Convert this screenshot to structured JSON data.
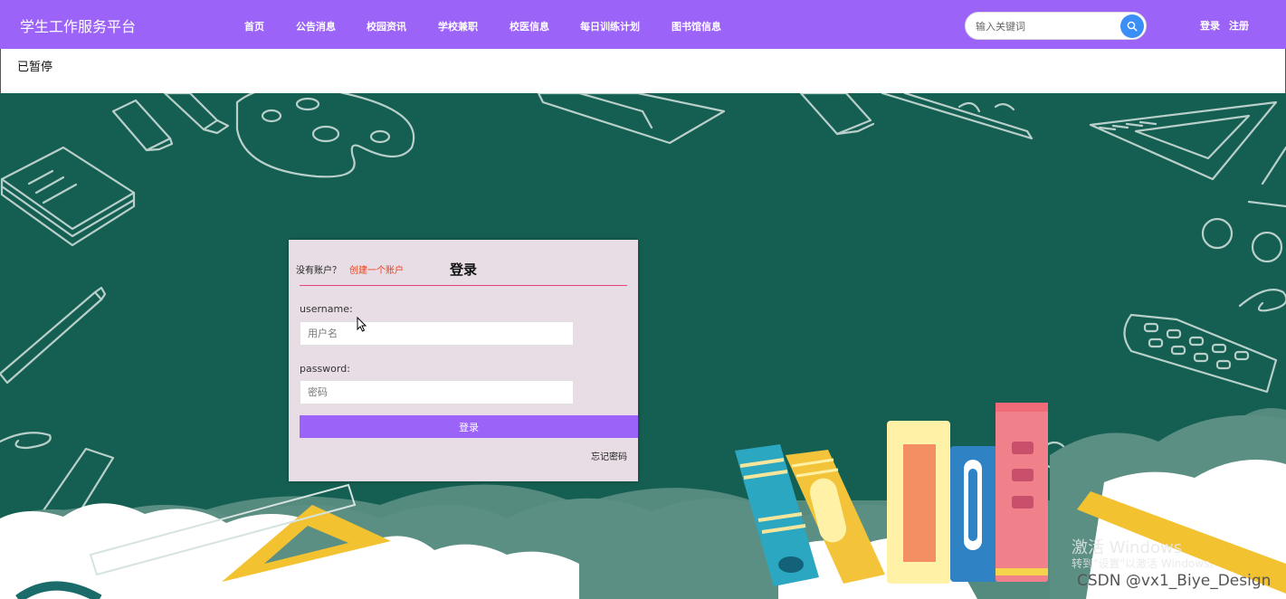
{
  "header": {
    "brand": "学生工作服务平台",
    "nav": [
      "首页",
      "公告消息",
      "校园资讯",
      "学校兼职",
      "校医信息",
      "每日训练计划",
      "图书馆信息"
    ],
    "search_placeholder": "输入关键词",
    "login_link": "登录",
    "register_link": "注册"
  },
  "status": {
    "text": "已暂停"
  },
  "login": {
    "no_account": "没有账户？",
    "create_account": "创建一个账户",
    "title": "登录",
    "username_label": "username:",
    "username_placeholder": "用户名",
    "password_label": "password:",
    "password_placeholder": "密码",
    "submit": "登录",
    "forgot": "忘记密码"
  },
  "overlay": {
    "activate_title": "激活 Windows",
    "activate_sub": "转到\"设置\"以激活 Windows。",
    "credit": "CSDN @vx1_Biye_Design"
  },
  "colors": {
    "accent": "#9b63f8",
    "chalkboard": "#155f52",
    "link_red": "#e8401c",
    "divider_pink": "#e4407a"
  }
}
